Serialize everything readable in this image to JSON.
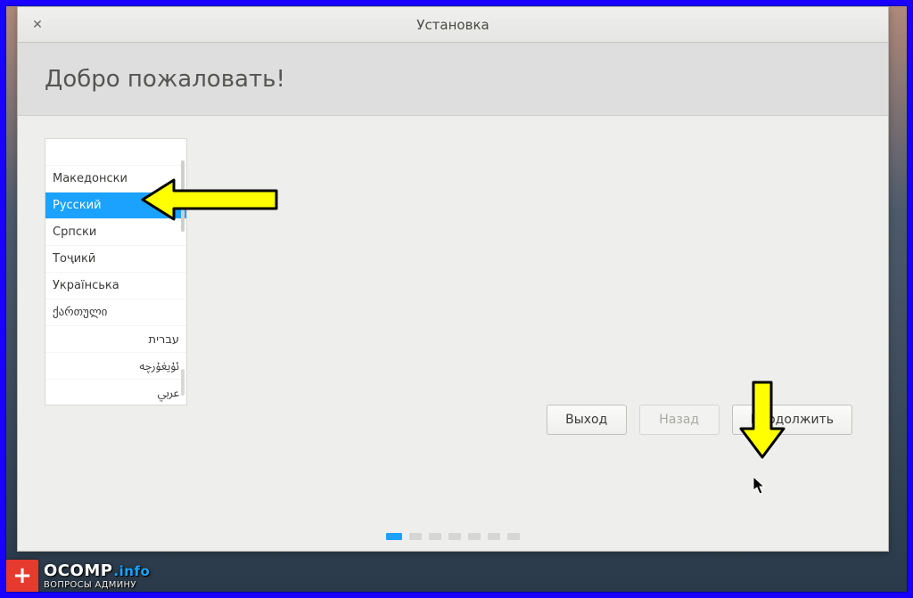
{
  "window": {
    "title": "Установка",
    "close_glyph": "✕"
  },
  "header": {
    "welcome": "Добро пожаловать!"
  },
  "languages": {
    "items": [
      {
        "label": "",
        "cutoff": true
      },
      {
        "label": "Македонски"
      },
      {
        "label": "Русский",
        "selected": true
      },
      {
        "label": "Српски"
      },
      {
        "label": "Тоҷикӣ"
      },
      {
        "label": "Українська"
      },
      {
        "label": "ქართული"
      },
      {
        "label": "עברית",
        "rtl": true
      },
      {
        "label": "ئۇيغۇرچە",
        "rtl": true
      },
      {
        "label": "عربي",
        "rtl": true
      }
    ]
  },
  "buttons": {
    "exit": "Выход",
    "back": "Назад",
    "continue": "Продолжить"
  },
  "pager": {
    "count": 7,
    "active": 0
  },
  "watermark": {
    "brand": "OCOMP",
    "domain": ".info",
    "tagline": "ВОПРОСЫ АДМИНУ"
  },
  "colors": {
    "accent": "#1ba2ff",
    "arrow_fill": "#ffff00",
    "arrow_stroke": "#000000"
  }
}
